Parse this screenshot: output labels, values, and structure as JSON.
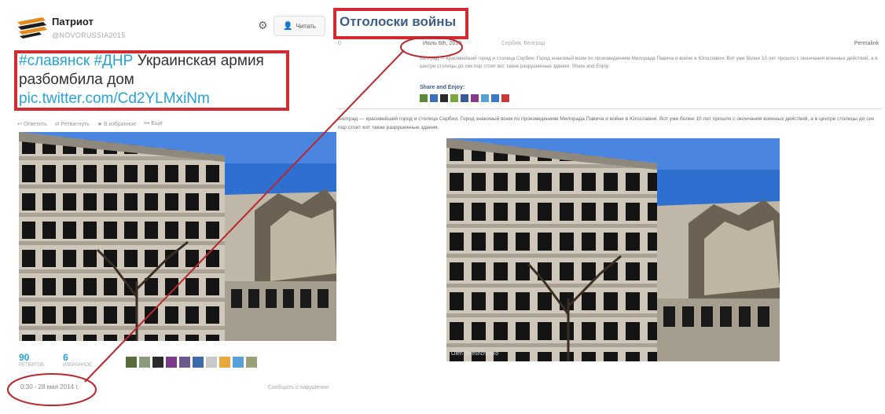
{
  "tweet": {
    "account_name": "Патриот",
    "account_handle": "@NOVORUSSIA2015",
    "follow_label": "Читать",
    "text_tag1": "#славянск",
    "text_tag2": "#ДНР",
    "text_body": "Украинская армия разбомбила дом",
    "text_link": "pic.twitter.com/Cd2YLMxiNm",
    "actions": [
      "Ответить",
      "Ретвитнуть",
      "В избранное",
      "Ещё"
    ],
    "retweets_count": "90",
    "retweets_label": "Ретвитов",
    "favorites_count": "6",
    "favorites_label": "Избранное",
    "date": "0:30 - 28 мая 2014 г.",
    "report": "Сообщить о нарушении",
    "photo_watermark": "Oleh Tereshchenko"
  },
  "blog": {
    "title": "Отголоски войны",
    "comments_count": "0",
    "date": "Июль 6th, 2010",
    "author": "Сербия, Белград",
    "permalink": "Permalink",
    "summary": "Белград — красивейший город и столица Сербии. Город знакомый всем по произведениям Милорада Павича и войне в Югославии. Вот уже более 10 лет прошло с окончания военных действий, а в центре столицы до сих пор стоит вот такие разрушенные здания. Share and Enjoy.",
    "share_title": "Share and Enjoy:",
    "body": "Белград — красивейший город и столица Сербии. Город знакомый всем по произведениям Милорада Павича и войне в Югославии. Вот уже более 10 лет прошло с окончания военных действий, а в центре столицы до сих пор стоит вот такие разрушенные здания.",
    "photo_watermark": "Oleh Tereshchenko"
  },
  "colors": {
    "twitter_blue": "#27a2d8",
    "blog_title": "#3f5e84",
    "annotation_red": "#d42a32",
    "annotation_line": "#b8282e",
    "sky": "#2f6fd0",
    "concrete": "#c9c2b4"
  },
  "icons": [
    "ribbon-flag-icon",
    "gear-icon",
    "follow-person-icon",
    "reply-icon",
    "retweet-icon",
    "favorite-star-icon",
    "more-icon"
  ]
}
